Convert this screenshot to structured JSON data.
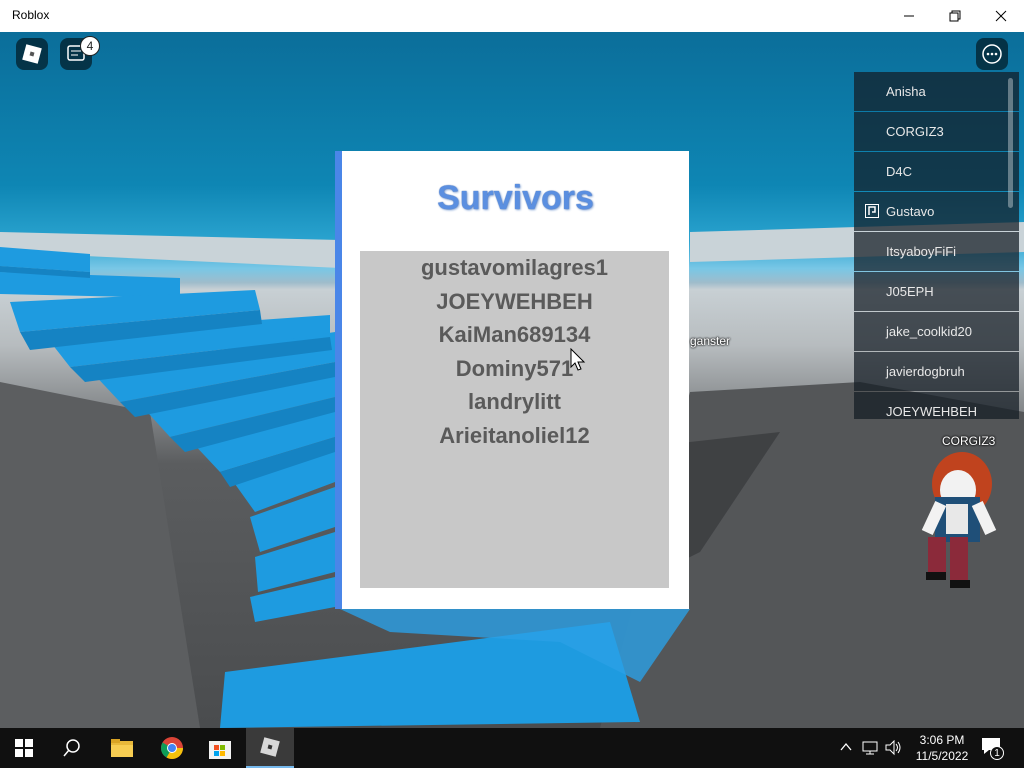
{
  "window": {
    "title": "Roblox"
  },
  "hud": {
    "chat_badge": "4"
  },
  "playerlist": {
    "players": [
      {
        "name": "Anisha"
      },
      {
        "name": "CORGIZ3"
      },
      {
        "name": "D4C"
      },
      {
        "name": "Gustavo"
      },
      {
        "name": "ItsyaboyFiFi"
      },
      {
        "name": "J05EPH"
      },
      {
        "name": "jake_coolkid20"
      },
      {
        "name": "javierdogbruh"
      },
      {
        "name": "JOEYWEHBEH"
      }
    ]
  },
  "world": {
    "nametag_ganster": "ganster",
    "nametag_corgiz3": "CORGIZ3"
  },
  "survivors_panel": {
    "title": "Survivors",
    "names": [
      "gustavomilagres1",
      "JOEYWEHBEH",
      "KaiMan689134",
      "Dominy571",
      "landrylitt",
      "Arieitanoliel12"
    ]
  },
  "taskbar": {
    "time": "3:06 PM",
    "date": "11/5/2022",
    "notification_count": "1",
    "apps": [
      "start-icon",
      "search-icon",
      "file-explorer-icon",
      "chrome-icon",
      "microsoft-store-icon",
      "roblox-icon"
    ]
  },
  "colors": {
    "panel_accent": "#4a86e8",
    "title_blue": "#5b8fe0",
    "stair_blue": "#1e9be0"
  }
}
